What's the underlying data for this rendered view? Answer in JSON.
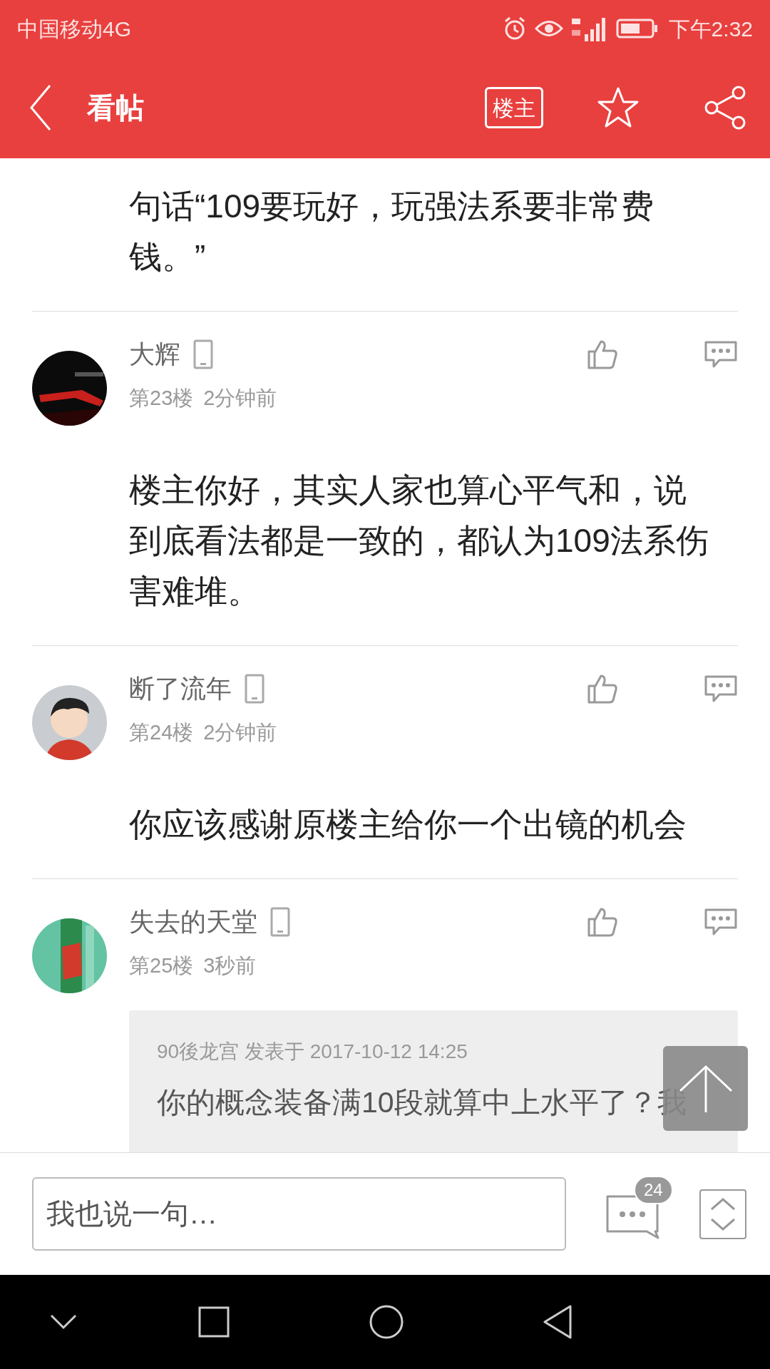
{
  "status_bar": {
    "carrier": "中国移动4G",
    "time": "下午2:32"
  },
  "header": {
    "title": "看帖",
    "op_button": "楼主"
  },
  "post_tail": {
    "text": "句话“109要玩好，玩强法系要非常费钱。”"
  },
  "comments": [
    {
      "name": "大辉",
      "floor": "第23楼",
      "time": "2分钟前",
      "text": "楼主你好，其实人家也算心平气和，说到底看法都是一致的，都认为109法系伤害难堆。"
    },
    {
      "name": "断了流年",
      "floor": "第24楼",
      "time": "2分钟前",
      "text": "你应该感谢原楼主给你一个出镜的机会"
    },
    {
      "name": "失去的天堂",
      "floor": "第25楼",
      "time": "3秒前",
      "quote": {
        "byline": "90後龙宫 发表于 2017-10-12 14:25",
        "text": "你的概念装备满10段就算中上水平了？我"
      }
    }
  ],
  "reply_bar": {
    "placeholder": "我也说一句…",
    "count": "24"
  }
}
